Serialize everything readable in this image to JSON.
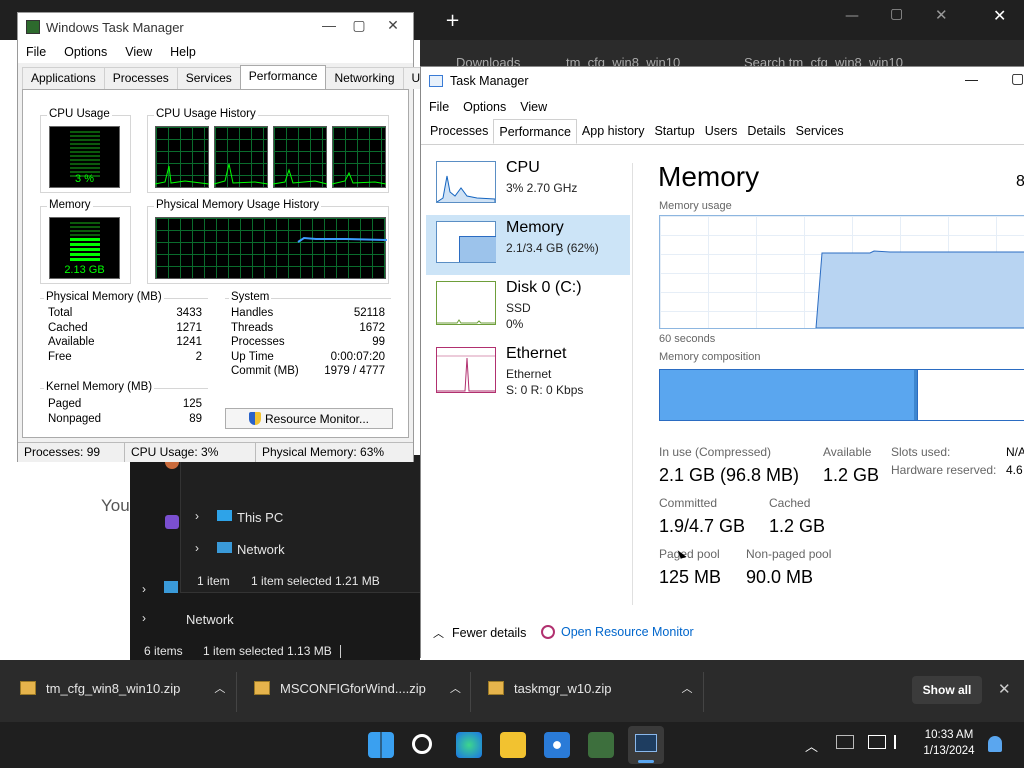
{
  "browser": {
    "new_tab_symbol": "+",
    "breadcrumb": [
      "Downloads",
      "tm_cfg_win8_win10"
    ],
    "search_placeholder": "Search tm_cfg_win8_win10",
    "you_text": "You"
  },
  "explorer_back": {
    "items": [
      "This PC",
      "Network"
    ],
    "status_count": "1 item",
    "status_selected": "1 item selected  1.21 MB"
  },
  "explorer_front": {
    "items": [
      "Network"
    ],
    "status_count": "6 items",
    "status_selected": "1 item selected  1.13 MB"
  },
  "old_tm": {
    "title": "Windows Task Manager",
    "menu": [
      "File",
      "Options",
      "View",
      "Help"
    ],
    "tabs": [
      "Applications",
      "Processes",
      "Services",
      "Performance",
      "Networking",
      "Users"
    ],
    "active_tab": "Performance",
    "cpu_usage_label": "CPU Usage",
    "cpu_usage_value": "3 %",
    "cpu_history_label": "CPU Usage History",
    "memory_label": "Memory",
    "memory_value": "2.13 GB",
    "phys_history_label": "Physical Memory Usage History",
    "physical_memory": {
      "label": "Physical Memory (MB)",
      "rows": [
        [
          "Total",
          "3433"
        ],
        [
          "Cached",
          "1271"
        ],
        [
          "Available",
          "1241"
        ],
        [
          "Free",
          "2"
        ]
      ]
    },
    "kernel_memory": {
      "label": "Kernel Memory (MB)",
      "rows": [
        [
          "Paged",
          "125"
        ],
        [
          "Nonpaged",
          "89"
        ]
      ]
    },
    "system": {
      "label": "System",
      "rows": [
        [
          "Handles",
          "52118"
        ],
        [
          "Threads",
          "1672"
        ],
        [
          "Processes",
          "99"
        ],
        [
          "Up Time",
          "0:00:07:20"
        ],
        [
          "Commit (MB)",
          "1979 / 4777"
        ]
      ]
    },
    "resource_button": "Resource Monitor...",
    "status": [
      "Processes: 99",
      "CPU Usage: 3%",
      "Physical Memory: 63%"
    ]
  },
  "new_tm": {
    "title": "Task Manager",
    "menu": [
      "File",
      "Options",
      "View"
    ],
    "tabs": [
      "Processes",
      "Performance",
      "App history",
      "Startup",
      "Users",
      "Details",
      "Services"
    ],
    "active_tab": "Performance",
    "sidebar": [
      {
        "title": "CPU",
        "sub1": "3% 2.70 GHz",
        "sub2": ""
      },
      {
        "title": "Memory",
        "sub1": "2.1/3.4 GB (62%)",
        "sub2": ""
      },
      {
        "title": "Disk 0 (C:)",
        "sub1": "SSD",
        "sub2": "0%"
      },
      {
        "title": "Ethernet",
        "sub1": "Ethernet",
        "sub2": "S: 0 R: 0 Kbps"
      }
    ],
    "selected_index": 1,
    "heading": "Memory",
    "heading_right": "8",
    "usage_label": "Memory usage",
    "seconds_label": "60 seconds",
    "composition_label": "Memory composition",
    "stats": {
      "in_use_label": "In use (Compressed)",
      "in_use": "2.1 GB (96.8 MB)",
      "available_label": "Available",
      "available": "1.2 GB",
      "committed_label": "Committed",
      "committed": "1.9/4.7 GB",
      "cached_label": "Cached",
      "cached": "1.2 GB",
      "paged_label": "Paged pool",
      "paged": "125 MB",
      "nonpaged_label": "Non-paged pool",
      "nonpaged": "90.0 MB",
      "slots_label": "Slots used:",
      "slots": "N/A",
      "hw_label": "Hardware reserved:",
      "hw": "4.6"
    },
    "fewer_details": "Fewer details",
    "open_resource_monitor": "Open Resource Monitor"
  },
  "downloads": [
    {
      "name": "tm_cfg_win8_win10.zip"
    },
    {
      "name": "MSCONFIGforWind....zip"
    },
    {
      "name": "taskmgr_w10.zip"
    }
  ],
  "show_all": "Show all",
  "clock": {
    "time": "10:33 AM",
    "date": "1/13/2024"
  },
  "colors": {
    "accent": "#0078d4",
    "memory_fill": "#5aa6ef",
    "graph_green": "#00ff00",
    "taskbar": "#1f1f1f"
  }
}
